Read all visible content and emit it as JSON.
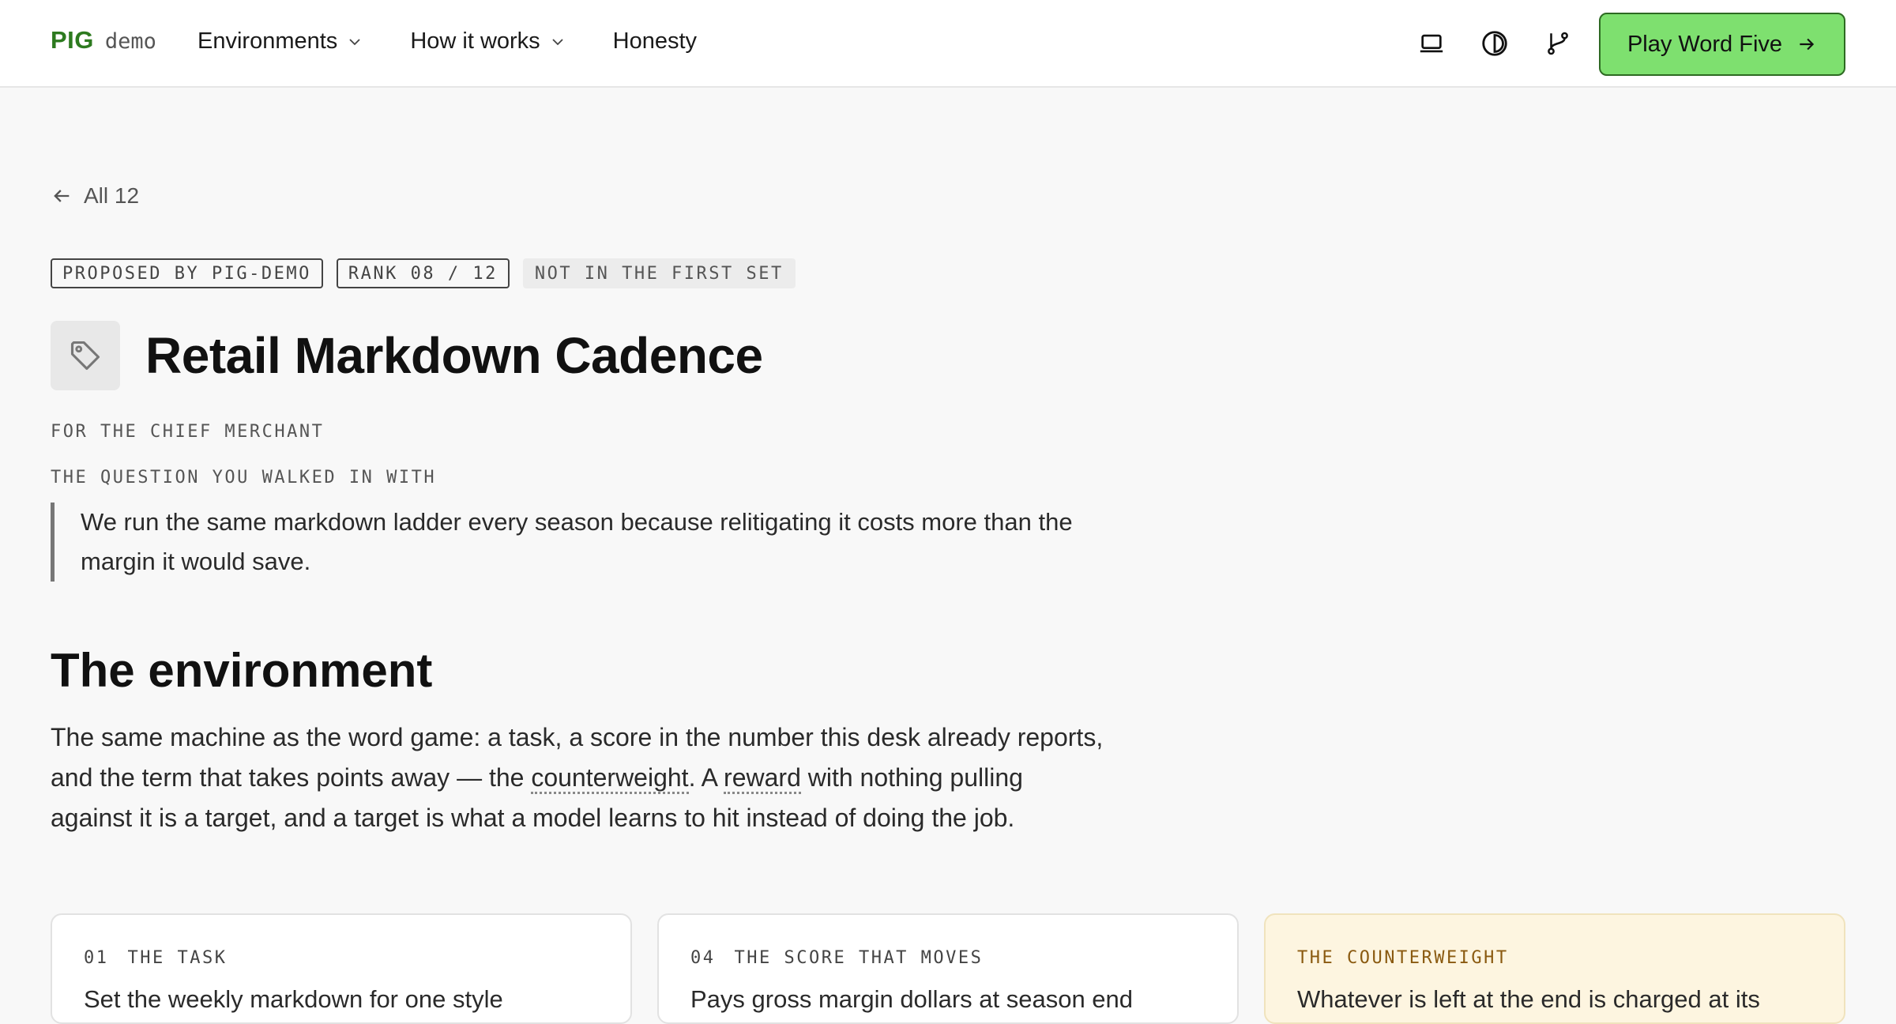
{
  "header": {
    "brand": "PIG",
    "brand_suffix": "demo",
    "nav": [
      {
        "label": "Environments",
        "has_dropdown": true
      },
      {
        "label": "How it works",
        "has_dropdown": true
      },
      {
        "label": "Honesty",
        "has_dropdown": false
      }
    ],
    "icons": [
      "laptop-icon",
      "contrast-icon",
      "branch-icon"
    ],
    "cta_label": "Play Word Five"
  },
  "back_link": "All 12",
  "tags": [
    "PROPOSED BY PIG-DEMO",
    "RANK 08 / 12",
    "NOT IN THE FIRST SET"
  ],
  "title": "Retail Markdown Cadence",
  "audience": "FOR THE CHIEF MERCHANT",
  "question_label": "THE QUESTION YOU WALKED IN WITH",
  "question": "We run the same markdown ladder every season because relitigating it costs more than the margin it would save.",
  "environment": {
    "heading": "The environment",
    "para_before": "The same machine as the word game: a task, a score in the number this desk already reports, and the term that takes points away — the ",
    "term1": "counterweight",
    "para_mid": ". A ",
    "term2": "reward",
    "para_after": " with nothing pulling against it is a target, and a target is what a model learns to hit instead of doing the job."
  },
  "cards": [
    {
      "num": "01",
      "label": "THE TASK",
      "body": "Set the weekly markdown for one style"
    },
    {
      "num": "04",
      "label": "THE SCORE THAT MOVES",
      "body": "Pays gross margin dollars at season end"
    },
    {
      "num": "",
      "label": "THE COUNTERWEIGHT",
      "body": "Whatever is left at the end is charged at its"
    }
  ],
  "colors": {
    "brand": "#2d7a1f",
    "cta": "#7ee06f",
    "warm_card": "#fdf5e0"
  }
}
